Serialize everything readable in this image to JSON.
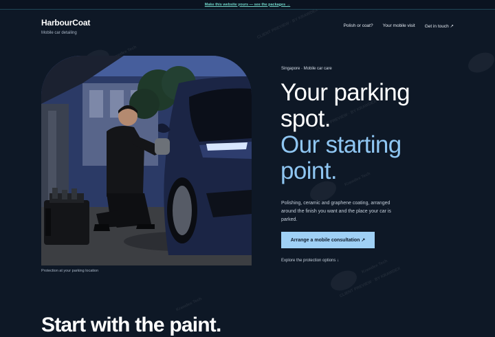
{
  "promo": {
    "text": "Make this website yours — see the packages →"
  },
  "brand": {
    "name": "HarbourCoat",
    "tagline": "Mobile car detailing"
  },
  "nav": {
    "items": [
      {
        "label": "Polish or coat?"
      },
      {
        "label": "Your mobile visit"
      },
      {
        "label": "Get in touch ↗"
      }
    ]
  },
  "hero": {
    "eyebrow": "Singapore · Mobile car care",
    "headline_line1": "Your parking spot.",
    "headline_line2": "Our starting point.",
    "lede": "Polishing, ceramic and graphene coating, arranged around the finish you want and the place your car is parked.",
    "cta_label": "Arrange a mobile consultation ↗",
    "explore_label": "Explore the protection options ↓",
    "photo_caption": "Protection at your parking location"
  },
  "next_section": {
    "title": "Start with the paint."
  },
  "watermark": {
    "line1": "Krawdex Tech",
    "line2": "CLIENT PREVIEW · BY KRAWDEX"
  },
  "colors": {
    "background": "#0e1826",
    "accent": "#9fd0f5",
    "accent_text": "#8fc6f2",
    "promo_link": "#6fd3c6"
  }
}
